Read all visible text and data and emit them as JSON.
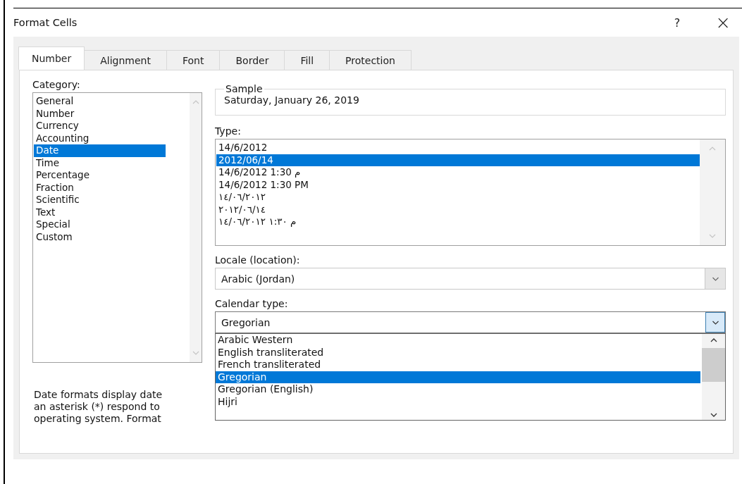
{
  "window": {
    "title": "Format Cells",
    "help": "?",
    "close": "×"
  },
  "tabs": [
    {
      "label": "Number",
      "selected": true
    },
    {
      "label": "Alignment",
      "selected": false
    },
    {
      "label": "Font",
      "selected": false
    },
    {
      "label": "Border",
      "selected": false
    },
    {
      "label": "Fill",
      "selected": false
    },
    {
      "label": "Protection",
      "selected": false
    }
  ],
  "category": {
    "label": "Category:",
    "items": [
      {
        "label": "General",
        "selected": false
      },
      {
        "label": "Number",
        "selected": false
      },
      {
        "label": "Currency",
        "selected": false
      },
      {
        "label": "Accounting",
        "selected": false
      },
      {
        "label": "Date",
        "selected": true
      },
      {
        "label": "Time",
        "selected": false
      },
      {
        "label": "Percentage",
        "selected": false
      },
      {
        "label": "Fraction",
        "selected": false
      },
      {
        "label": "Scientific",
        "selected": false
      },
      {
        "label": "Text",
        "selected": false
      },
      {
        "label": "Special",
        "selected": false
      },
      {
        "label": "Custom",
        "selected": false
      }
    ]
  },
  "sample": {
    "label": "Sample",
    "value": "Saturday, January 26, 2019"
  },
  "type": {
    "label": "Type:",
    "items": [
      {
        "label": "14/6/2012",
        "selected": false
      },
      {
        "label": "2012/06/14",
        "selected": true
      },
      {
        "label": "14/6/2012 1:30 م",
        "selected": false
      },
      {
        "label": "14/6/2012 1:30 PM",
        "selected": false
      },
      {
        "label": "١٤/٠٦/٢٠١٢",
        "selected": false
      },
      {
        "label": "٢٠١٢/٠٦/١٤",
        "selected": false
      },
      {
        "label": "١٤/٠٦/٢٠١٢ ١:٣٠ م",
        "selected": false
      }
    ]
  },
  "locale": {
    "label": "Locale (location):",
    "value": "Arabic (Jordan)"
  },
  "calendar": {
    "label": "Calendar type:",
    "value": "Gregorian",
    "expanded": true,
    "options": [
      {
        "label": "Arabic Western",
        "selected": false
      },
      {
        "label": "English transliterated",
        "selected": false
      },
      {
        "label": "French transliterated",
        "selected": false
      },
      {
        "label": "Gregorian",
        "selected": true
      },
      {
        "label": "Gregorian (English)",
        "selected": false
      },
      {
        "label": "Hijri",
        "selected": false
      }
    ]
  },
  "description": [
    "Date formats display date",
    "an asterisk (*) respond to",
    "operating system. Format"
  ]
}
